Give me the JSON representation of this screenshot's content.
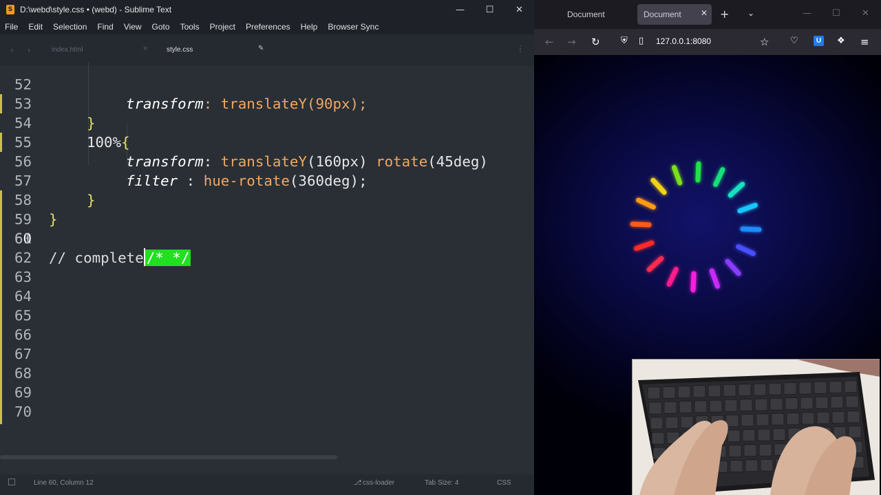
{
  "sublime": {
    "title": "D:\\webd\\style.css • (webd) - Sublime Text",
    "menu": [
      "File",
      "Edit",
      "Selection",
      "Find",
      "View",
      "Goto",
      "Tools",
      "Project",
      "Preferences",
      "Help",
      "Browser Sync"
    ],
    "tabs": [
      {
        "label": "index.html",
        "active": false
      },
      {
        "label": "style.css",
        "active": true
      }
    ],
    "lines": [
      {
        "num": "52",
        "text": "transform: translateY(90px);"
      },
      {
        "num": "53",
        "text": "}"
      },
      {
        "num": "54",
        "text": "100%{"
      },
      {
        "num": "55",
        "text": "transform: translateY(160px) rotate(45deg)"
      },
      {
        "num": "56",
        "text": "filter : hue-rotate(360deg);"
      },
      {
        "num": "57",
        "text": "}"
      },
      {
        "num": "58",
        "text": "}"
      },
      {
        "num": "59",
        "text": ""
      },
      {
        "num": "60",
        "text": "// complete",
        "selection": "/* */"
      },
      {
        "num": "61",
        "text": ""
      },
      {
        "num": "62",
        "text": ""
      },
      {
        "num": "63",
        "text": ""
      },
      {
        "num": "64",
        "text": ""
      },
      {
        "num": "65",
        "text": ""
      },
      {
        "num": "66",
        "text": ""
      },
      {
        "num": "67",
        "text": ""
      },
      {
        "num": "68",
        "text": ""
      },
      {
        "num": "69",
        "text": ""
      },
      {
        "num": "70",
        "text": ""
      }
    ],
    "code": {
      "l52_prop": "transform",
      "l52_rest": ": translateY(90px);",
      "l53": "}",
      "l54_pct": "100%",
      "l54_brace": "{",
      "l55_prop": "transform",
      "l55_colon": ": ",
      "l55_fn1": "translateY",
      "l55_arg1": "(160px) ",
      "l55_fn2": "rotate",
      "l55_arg2": "(45deg)",
      "l56_prop": "filter",
      "l56_colon": " : ",
      "l56_fn": "hue-rotate",
      "l56_arg": "(360deg);",
      "l57": "}",
      "l58": "}",
      "l60_comment": "// complete",
      "l60_sel": "/* */"
    },
    "status": {
      "position": "Line 60, Column 12",
      "plugin": "css-loader",
      "tab_size": "Tab Size: 4",
      "syntax": "CSS"
    },
    "window_controls": [
      "—",
      "☐",
      "✕"
    ]
  },
  "firefox": {
    "tabs": [
      {
        "label": "Document",
        "active": false
      },
      {
        "label": "Document",
        "active": true
      }
    ],
    "url": "127.0.0.1:8080",
    "page": {
      "loader_colors": [
        "#ff2a2a",
        "#ff5a14",
        "#ff9a14",
        "#f2d214",
        "#7ae01e",
        "#22e04a",
        "#14e07a",
        "#14e0c0",
        "#14c8ff",
        "#1e8cff",
        "#4a50ff",
        "#8a3cff",
        "#c82aff",
        "#ff1ee0",
        "#ff1a8c",
        "#ff2a50"
      ]
    }
  }
}
